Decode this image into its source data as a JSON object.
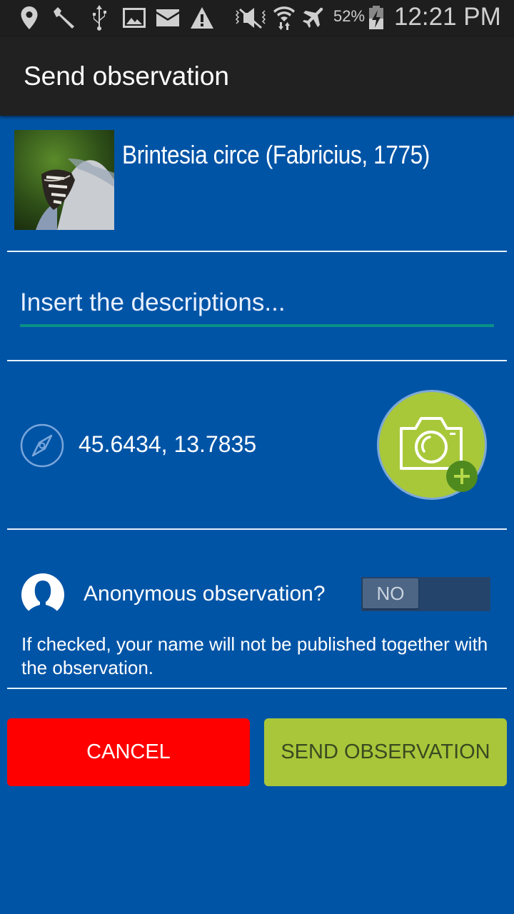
{
  "status_bar": {
    "icons": [
      "location-icon",
      "wrench-icon",
      "usb-icon",
      "image-icon",
      "mail-icon",
      "warning-icon",
      "mute-icon",
      "wifi-icon",
      "airplane-icon",
      "battery-charging-icon"
    ],
    "battery_percent": "52%",
    "time": "12:21 PM"
  },
  "action_bar": {
    "title": "Send observation"
  },
  "species": {
    "name": "Brintesia circe (Fabricius, 1775)",
    "thumbnail_icon": "butterfly-photo"
  },
  "description": {
    "value": "",
    "placeholder": "Insert the descriptions..."
  },
  "location": {
    "icon": "compass-icon",
    "coordinates": "45.6434, 13.7835"
  },
  "camera": {
    "icon": "camera-add-icon"
  },
  "anonymous": {
    "label": "Anonymous observation?",
    "toggle_state": "NO",
    "hint": "If checked, your name will not be published together with the observation."
  },
  "buttons": {
    "cancel": "CANCEL",
    "send": "SEND OBSERVATION"
  },
  "colors": {
    "background": "#0054a6",
    "cancel": "#ff0000",
    "send": "#a9c63b",
    "input_underline": "#0a9088"
  }
}
